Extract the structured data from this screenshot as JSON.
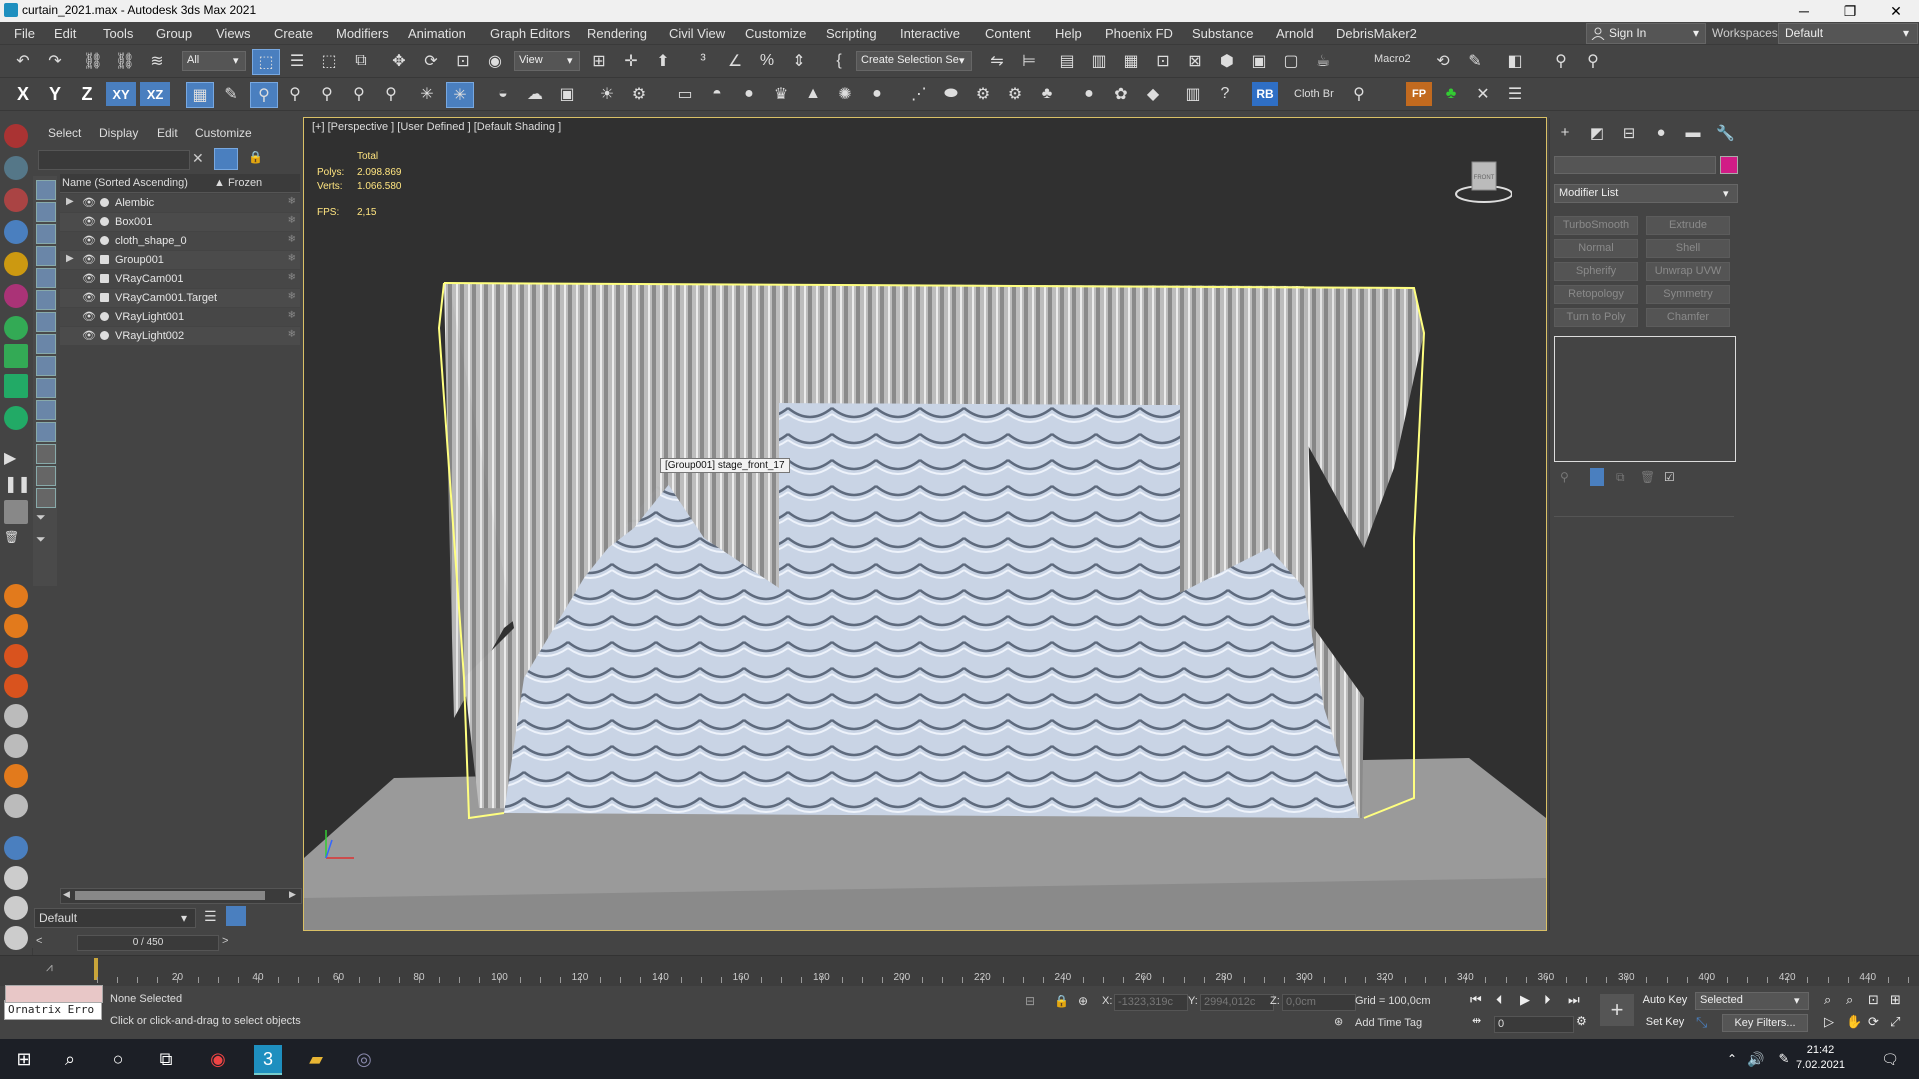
{
  "window": {
    "title": "curtain_2021.max - Autodesk 3ds Max 2021",
    "min": "─",
    "restore": "❐",
    "close": "✕"
  },
  "menu": [
    "File",
    "Edit",
    "Tools",
    "Group",
    "Views",
    "Create",
    "Modifiers",
    "Animation",
    "Graph Editors",
    "Rendering",
    "Civil View",
    "Customize",
    "Scripting",
    "Interactive",
    "Content",
    "Help",
    "Phoenix FD",
    "Substance",
    "Arnold",
    "DebrisMaker2"
  ],
  "account": {
    "sign_in": "Sign In",
    "workspaces_label": "Workspaces:",
    "workspace": "Default"
  },
  "toolbar1": {
    "filter": "All",
    "view": "View",
    "selection_set": "Create Selection Se",
    "macro": "Macro2"
  },
  "toolbar2": {
    "axes": [
      "X",
      "Y",
      "Z",
      "XY",
      "XZ"
    ],
    "rb": "RB",
    "cloth": "Cloth Br",
    "fp": "FP"
  },
  "explorer": {
    "tabs": [
      "Select",
      "Display",
      "Edit",
      "Customize"
    ],
    "col_name": "Name (Sorted Ascending)",
    "col_frozen": "▲ Frozen",
    "objects": [
      {
        "name": "Alembic",
        "expand": "▶"
      },
      {
        "name": "Box001",
        "expand": ""
      },
      {
        "name": "cloth_shape_0",
        "expand": ""
      },
      {
        "name": "Group001",
        "expand": "▶"
      },
      {
        "name": "VRayCam001",
        "expand": ""
      },
      {
        "name": "VRayCam001.Target",
        "expand": ""
      },
      {
        "name": "VRayLight001",
        "expand": ""
      },
      {
        "name": "VRayLight002",
        "expand": ""
      }
    ],
    "layer": "Default"
  },
  "viewport": {
    "label": "[+] [Perspective ] [User Defined ] [Default Shading ]",
    "stats_total": "Total",
    "polys_label": "Polys:",
    "polys": "2.098.869",
    "verts_label": "Verts:",
    "verts": "1.066.580",
    "fps_label": "FPS:",
    "fps": "2,15",
    "tooltip": "[Group001] stage_front_17",
    "viewcube": "FRONT"
  },
  "command_panel": {
    "modifier_list": "Modifier List",
    "modifiers": [
      "TurboSmooth",
      "Extrude",
      "Normal",
      "Shell",
      "Spherify",
      "Unwrap UVW",
      "Retopology",
      "Symmetry",
      "Turn to Poly",
      "Chamfer"
    ],
    "color": "#d11c86"
  },
  "timeline": {
    "frame": "0 / 450",
    "ticks": [
      "20",
      "40",
      "60",
      "80",
      "100",
      "120",
      "140",
      "160",
      "180",
      "200",
      "220",
      "240",
      "260",
      "280",
      "300",
      "320",
      "340",
      "360",
      "380",
      "400",
      "420",
      "440"
    ]
  },
  "status": {
    "error_field": "Ornatrix Erro",
    "selection": "None Selected",
    "prompt": "Click or click-and-drag to select objects",
    "x_label": "X:",
    "x": "-1323,319c",
    "y_label": "Y:",
    "y": "2994,012c",
    "z_label": "Z:",
    "z": "0,0cm",
    "grid": "Grid = 100,0cm",
    "add_time_tag": "Add Time Tag",
    "auto_key": "Auto Key",
    "set_key": "Set Key",
    "selected": "Selected",
    "key_filters": "Key Filters...",
    "frame_field": "0"
  },
  "taskbar": {
    "time": "21:42",
    "date": "7.02.2021"
  }
}
